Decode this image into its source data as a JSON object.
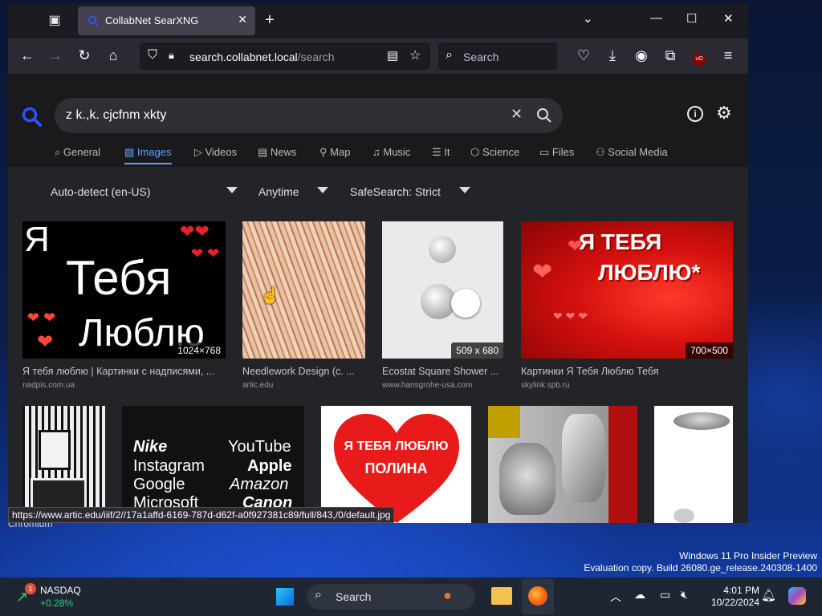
{
  "browser": {
    "tab_title": "CollabNet SearXNG",
    "url_host": "search.collabnet.local",
    "url_path": "/search",
    "search_placeholder": "Search"
  },
  "search": {
    "query": "z k.,k. cjcfnm xkty"
  },
  "categories": [
    {
      "label": "General",
      "icon": "search-icon"
    },
    {
      "label": "Images",
      "icon": "image-icon",
      "active": true
    },
    {
      "label": "Videos",
      "icon": "play-icon"
    },
    {
      "label": "News",
      "icon": "newspaper-icon"
    },
    {
      "label": "Map",
      "icon": "map-pin-icon"
    },
    {
      "label": "Music",
      "icon": "music-icon"
    },
    {
      "label": "It",
      "icon": "layers-icon"
    },
    {
      "label": "Science",
      "icon": "cube-icon"
    },
    {
      "label": "Files",
      "icon": "folder-icon"
    },
    {
      "label": "Social Media",
      "icon": "people-icon"
    }
  ],
  "filters": {
    "language": "Auto-detect (en-US)",
    "time": "Anytime",
    "safesearch": "SafeSearch: Strict"
  },
  "results": [
    {
      "title": "Я тебя люблю | Картинки с надписями, ...",
      "source": "nadpis.com.ua",
      "dims": "1024×768",
      "text1": "Я",
      "text2": "Тебя",
      "text3": "Люблю"
    },
    {
      "title": "Needlework Design (с. ...",
      "source": "artic.edu",
      "dims": ""
    },
    {
      "title": "Ecostat Square Shower ...",
      "source": "www.hansgrohe-usa.com",
      "dims": "509 x 680"
    },
    {
      "title": "Картинки Я Тебя Люблю Тебя",
      "source": "skylink.spb.ru",
      "dims": "700×500",
      "text1": "Я ТЕБЯ",
      "text2": "ЛЮБЛЮ*"
    }
  ],
  "row2": {
    "brands": [
      "Nike",
      "YouTube",
      "Instagram",
      "Apple",
      "Google",
      "Amazon",
      "Microsoft",
      "Canon"
    ],
    "heart_text1": "Я ТЕБЯ ЛЮБЛЮ",
    "heart_text2": "ПОЛИНА"
  },
  "status_url": "https://www.artic.edu/iiif/2//17a1affd-6169-787d-d62f-a0f927381c89/full/843,/0/default.jpg",
  "desktop": {
    "app_label": "Chromium",
    "watermark1": "Windows 11 Pro Insider Preview",
    "watermark2": "Evaluation copy. Build 26080.ge_release.240308-1400"
  },
  "taskbar": {
    "stock_name": "NASDAQ",
    "stock_change": "+0.28%",
    "badge": "1",
    "search": "Search",
    "time": "4:01 PM",
    "date": "10/22/2024"
  }
}
